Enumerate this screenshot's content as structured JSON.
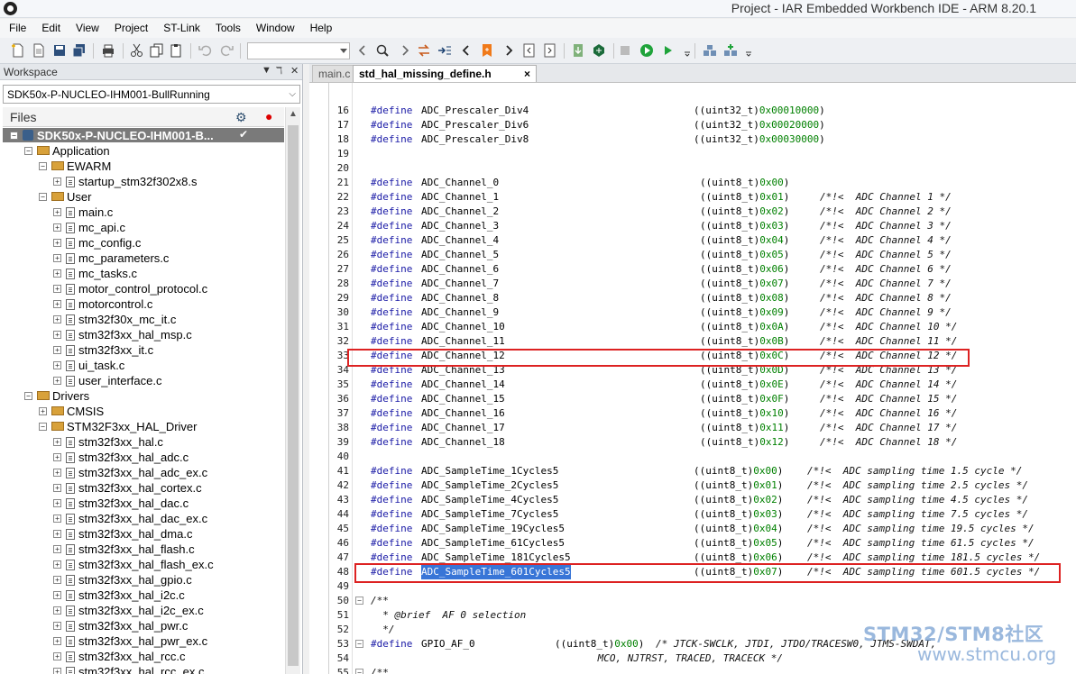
{
  "window": {
    "title": "Project - IAR Embedded Workbench IDE - ARM 8.20.1"
  },
  "menu": [
    "File",
    "Edit",
    "View",
    "Project",
    "ST-Link",
    "Tools",
    "Window",
    "Help"
  ],
  "workspace": {
    "header": "Workspace",
    "controls": [
      "▼",
      "ℸ",
      "✕"
    ],
    "config": "SDK50x-P-NUCLEO-IHM001-BullRunning",
    "files_label": "Files",
    "tree": [
      {
        "label": "SDK50x-P-NUCLEO-IHM001-B...",
        "indent": 0,
        "kind": "project",
        "exp": "−",
        "selected": true
      },
      {
        "label": "Application",
        "indent": 1,
        "kind": "folder",
        "exp": "−"
      },
      {
        "label": "EWARM",
        "indent": 2,
        "kind": "folder",
        "exp": "−"
      },
      {
        "label": "startup_stm32f302x8.s",
        "indent": 3,
        "kind": "file",
        "exp": "+"
      },
      {
        "label": "User",
        "indent": 2,
        "kind": "folder",
        "exp": "−"
      },
      {
        "label": "main.c",
        "indent": 3,
        "kind": "file",
        "exp": "+"
      },
      {
        "label": "mc_api.c",
        "indent": 3,
        "kind": "file",
        "exp": "+"
      },
      {
        "label": "mc_config.c",
        "indent": 3,
        "kind": "file",
        "exp": "+"
      },
      {
        "label": "mc_parameters.c",
        "indent": 3,
        "kind": "file",
        "exp": "+"
      },
      {
        "label": "mc_tasks.c",
        "indent": 3,
        "kind": "file",
        "exp": "+"
      },
      {
        "label": "motor_control_protocol.c",
        "indent": 3,
        "kind": "file",
        "exp": "+"
      },
      {
        "label": "motorcontrol.c",
        "indent": 3,
        "kind": "file",
        "exp": "+"
      },
      {
        "label": "stm32f30x_mc_it.c",
        "indent": 3,
        "kind": "file",
        "exp": "+"
      },
      {
        "label": "stm32f3xx_hal_msp.c",
        "indent": 3,
        "kind": "file",
        "exp": "+"
      },
      {
        "label": "stm32f3xx_it.c",
        "indent": 3,
        "kind": "file",
        "exp": "+"
      },
      {
        "label": "ui_task.c",
        "indent": 3,
        "kind": "file",
        "exp": "+"
      },
      {
        "label": "user_interface.c",
        "indent": 3,
        "kind": "file",
        "exp": "+"
      },
      {
        "label": "Drivers",
        "indent": 1,
        "kind": "folder",
        "exp": "−"
      },
      {
        "label": "CMSIS",
        "indent": 2,
        "kind": "folder",
        "exp": "+"
      },
      {
        "label": "STM32F3xx_HAL_Driver",
        "indent": 2,
        "kind": "folder",
        "exp": "−"
      },
      {
        "label": "stm32f3xx_hal.c",
        "indent": 3,
        "kind": "file",
        "exp": "+"
      },
      {
        "label": "stm32f3xx_hal_adc.c",
        "indent": 3,
        "kind": "file",
        "exp": "+"
      },
      {
        "label": "stm32f3xx_hal_adc_ex.c",
        "indent": 3,
        "kind": "file",
        "exp": "+"
      },
      {
        "label": "stm32f3xx_hal_cortex.c",
        "indent": 3,
        "kind": "file",
        "exp": "+"
      },
      {
        "label": "stm32f3xx_hal_dac.c",
        "indent": 3,
        "kind": "file",
        "exp": "+"
      },
      {
        "label": "stm32f3xx_hal_dac_ex.c",
        "indent": 3,
        "kind": "file",
        "exp": "+"
      },
      {
        "label": "stm32f3xx_hal_dma.c",
        "indent": 3,
        "kind": "file",
        "exp": "+"
      },
      {
        "label": "stm32f3xx_hal_flash.c",
        "indent": 3,
        "kind": "file",
        "exp": "+"
      },
      {
        "label": "stm32f3xx_hal_flash_ex.c",
        "indent": 3,
        "kind": "file",
        "exp": "+"
      },
      {
        "label": "stm32f3xx_hal_gpio.c",
        "indent": 3,
        "kind": "file",
        "exp": "+"
      },
      {
        "label": "stm32f3xx_hal_i2c.c",
        "indent": 3,
        "kind": "file",
        "exp": "+"
      },
      {
        "label": "stm32f3xx_hal_i2c_ex.c",
        "indent": 3,
        "kind": "file",
        "exp": "+"
      },
      {
        "label": "stm32f3xx_hal_pwr.c",
        "indent": 3,
        "kind": "file",
        "exp": "+"
      },
      {
        "label": "stm32f3xx_hal_pwr_ex.c",
        "indent": 3,
        "kind": "file",
        "exp": "+"
      },
      {
        "label": "stm32f3xx_hal_rcc.c",
        "indent": 3,
        "kind": "file",
        "exp": "+"
      },
      {
        "label": "stm32f3xx_hal_rcc_ex.c",
        "indent": 3,
        "kind": "file",
        "exp": "+"
      }
    ]
  },
  "editor": {
    "tabs": [
      {
        "label": "main.c",
        "active": false
      },
      {
        "label": "std_hal_missing_define.h",
        "active": true
      }
    ],
    "close_glyph": "×",
    "highlighted_lines": [
      33,
      48
    ],
    "selected_text": "ADC_SampleTime_601Cycles5",
    "lines": [
      {
        "n": "16",
        "name": "ADC_Prescaler_Div4",
        "cast": "((uint32_t)",
        "val": "0x00010000",
        "tail": ")",
        "comment": ""
      },
      {
        "n": "17",
        "name": "ADC_Prescaler_Div6",
        "cast": "((uint32_t)",
        "val": "0x00020000",
        "tail": ")",
        "comment": ""
      },
      {
        "n": "18",
        "name": "ADC_Prescaler_Div8",
        "cast": "((uint32_t)",
        "val": "0x00030000",
        "tail": ")",
        "comment": ""
      },
      {
        "n": "19",
        "raw": ""
      },
      {
        "n": "20",
        "raw": ""
      },
      {
        "n": "21",
        "name": "ADC_Channel_0",
        "cast": "((uint8_t)",
        "val": "0x00",
        "tail": ")",
        "comment": ""
      },
      {
        "n": "22",
        "name": "ADC_Channel_1",
        "cast": "((uint8_t)",
        "val": "0x01",
        "tail": ")",
        "comment": "/*!<  ADC Channel 1 */"
      },
      {
        "n": "23",
        "name": "ADC_Channel_2",
        "cast": "((uint8_t)",
        "val": "0x02",
        "tail": ")",
        "comment": "/*!<  ADC Channel 2 */"
      },
      {
        "n": "24",
        "name": "ADC_Channel_3",
        "cast": "((uint8_t)",
        "val": "0x03",
        "tail": ")",
        "comment": "/*!<  ADC Channel 3 */"
      },
      {
        "n": "25",
        "name": "ADC_Channel_4",
        "cast": "((uint8_t)",
        "val": "0x04",
        "tail": ")",
        "comment": "/*!<  ADC Channel 4 */"
      },
      {
        "n": "26",
        "name": "ADC_Channel_5",
        "cast": "((uint8_t)",
        "val": "0x05",
        "tail": ")",
        "comment": "/*!<  ADC Channel 5 */"
      },
      {
        "n": "27",
        "name": "ADC_Channel_6",
        "cast": "((uint8_t)",
        "val": "0x06",
        "tail": ")",
        "comment": "/*!<  ADC Channel 6 */"
      },
      {
        "n": "28",
        "name": "ADC_Channel_7",
        "cast": "((uint8_t)",
        "val": "0x07",
        "tail": ")",
        "comment": "/*!<  ADC Channel 7 */"
      },
      {
        "n": "29",
        "name": "ADC_Channel_8",
        "cast": "((uint8_t)",
        "val": "0x08",
        "tail": ")",
        "comment": "/*!<  ADC Channel 8 */"
      },
      {
        "n": "30",
        "name": "ADC_Channel_9",
        "cast": "((uint8_t)",
        "val": "0x09",
        "tail": ")",
        "comment": "/*!<  ADC Channel 9 */"
      },
      {
        "n": "31",
        "name": "ADC_Channel_10",
        "cast": "((uint8_t)",
        "val": "0x0A",
        "tail": ")",
        "comment": "/*!<  ADC Channel 10 */"
      },
      {
        "n": "32",
        "name": "ADC_Channel_11",
        "cast": "((uint8_t)",
        "val": "0x0B",
        "tail": ")",
        "comment": "/*!<  ADC Channel 11 */"
      },
      {
        "n": "33",
        "name": "ADC_Channel_12",
        "cast": "((uint8_t)",
        "val": "0x0C",
        "tail": ")",
        "comment": "/*!<  ADC Channel 12 */"
      },
      {
        "n": "34",
        "name": "ADC_Channel_13",
        "cast": "((uint8_t)",
        "val": "0x0D",
        "tail": ")",
        "comment": "/*!<  ADC Channel 13 */"
      },
      {
        "n": "35",
        "name": "ADC_Channel_14",
        "cast": "((uint8_t)",
        "val": "0x0E",
        "tail": ")",
        "comment": "/*!<  ADC Channel 14 */"
      },
      {
        "n": "36",
        "name": "ADC_Channel_15",
        "cast": "((uint8_t)",
        "val": "0x0F",
        "tail": ")",
        "comment": "/*!<  ADC Channel 15 */"
      },
      {
        "n": "37",
        "name": "ADC_Channel_16",
        "cast": "((uint8_t)",
        "val": "0x10",
        "tail": ")",
        "comment": "/*!<  ADC Channel 16 */"
      },
      {
        "n": "38",
        "name": "ADC_Channel_17",
        "cast": "((uint8_t)",
        "val": "0x11",
        "tail": ")",
        "comment": "/*!<  ADC Channel 17 */"
      },
      {
        "n": "39",
        "name": "ADC_Channel_18",
        "cast": "((uint8_t)",
        "val": "0x12",
        "tail": ")",
        "comment": "/*!<  ADC Channel 18 */"
      },
      {
        "n": "40",
        "raw": ""
      },
      {
        "n": "41",
        "name": "ADC_SampleTime_1Cycles5",
        "cast": "((uint8_t)",
        "val": "0x00",
        "tail": ")",
        "comment": "/*!<  ADC sampling time 1.5 cycle */"
      },
      {
        "n": "42",
        "name": "ADC_SampleTime_2Cycles5",
        "cast": "((uint8_t)",
        "val": "0x01",
        "tail": ")",
        "comment": "/*!<  ADC sampling time 2.5 cycles */"
      },
      {
        "n": "43",
        "name": "ADC_SampleTime_4Cycles5",
        "cast": "((uint8_t)",
        "val": "0x02",
        "tail": ")",
        "comment": "/*!<  ADC sampling time 4.5 cycles */"
      },
      {
        "n": "44",
        "name": "ADC_SampleTime_7Cycles5",
        "cast": "((uint8_t)",
        "val": "0x03",
        "tail": ")",
        "comment": "/*!<  ADC sampling time 7.5 cycles */"
      },
      {
        "n": "45",
        "name": "ADC_SampleTime_19Cycles5",
        "cast": "((uint8_t)",
        "val": "0x04",
        "tail": ")",
        "comment": "/*!<  ADC sampling time 19.5 cycles */"
      },
      {
        "n": "46",
        "name": "ADC_SampleTime_61Cycles5",
        "cast": "((uint8_t)",
        "val": "0x05",
        "tail": ")",
        "comment": "/*!<  ADC sampling time 61.5 cycles */"
      },
      {
        "n": "47",
        "name": "ADC_SampleTime_181Cycles5",
        "cast": "((uint8_t)",
        "val": "0x06",
        "tail": ")",
        "comment": "/*!<  ADC sampling time 181.5 cycles */"
      },
      {
        "n": "48",
        "name": "ADC_SampleTime_601Cycles5",
        "cast": "((uint8_t)",
        "val": "0x07",
        "tail": ")",
        "comment": "/*!<  ADC sampling time 601.5 cycles */"
      },
      {
        "n": "49",
        "raw": ""
      },
      {
        "n": "50",
        "raw": "/**",
        "fold": "−",
        "style": "cm"
      },
      {
        "n": "51",
        "raw": "  * @brief  AF 0 selection",
        "style": "cm"
      },
      {
        "n": "52",
        "raw": "  */",
        "style": "cm"
      },
      {
        "n": "53",
        "name": "GPIO_AF_0",
        "cast": "((uint8_t)",
        "val": "0x00",
        "tail": ")",
        "comment": "/* JTCK-SWCLK, JTDI, JTDO/TRACESW0, JTMS-SWDAT,",
        "fold": "−",
        "short": true
      },
      {
        "n": "54",
        "raw": "                                      MCO, NJTRST, TRACED, TRACECK */",
        "style": "cm"
      },
      {
        "n": "55",
        "raw": "/**",
        "fold": "−",
        "style": "cm"
      }
    ],
    "define_kw": "#define"
  },
  "watermark": {
    "line1": "STM32/STM8社区",
    "line2": "www.stmcu.org"
  }
}
